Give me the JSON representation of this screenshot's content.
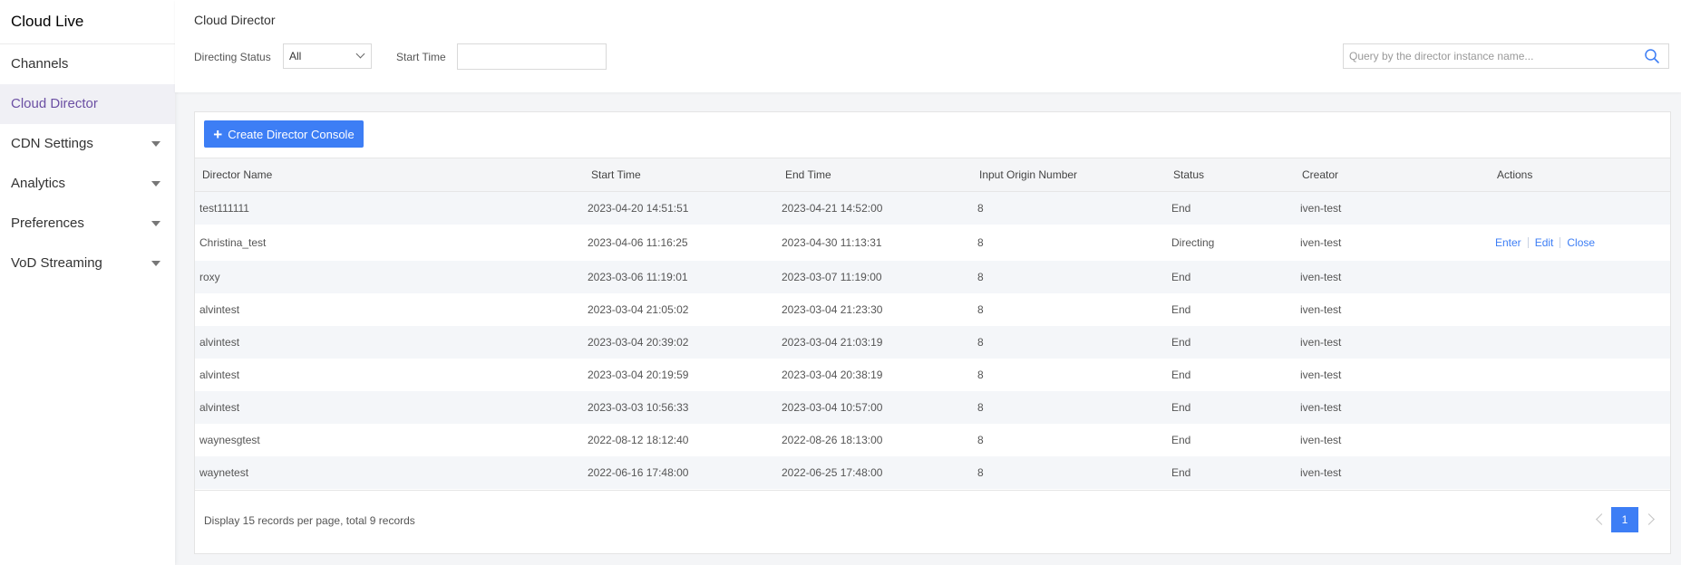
{
  "sidebar": {
    "brand": "Cloud Live",
    "items": [
      {
        "label": "Channels",
        "active": false,
        "expandable": false
      },
      {
        "label": "Cloud Director",
        "active": true,
        "expandable": false
      },
      {
        "label": "CDN Settings",
        "active": false,
        "expandable": true
      },
      {
        "label": "Analytics",
        "active": false,
        "expandable": true
      },
      {
        "label": "Preferences",
        "active": false,
        "expandable": true
      },
      {
        "label": "VoD Streaming",
        "active": false,
        "expandable": true
      }
    ]
  },
  "header": {
    "title": "Cloud Director",
    "filters": {
      "status_label": "Directing Status",
      "status_value": "All",
      "start_time_label": "Start Time",
      "start_time_value": ""
    },
    "search": {
      "placeholder": "Query by the director instance name..."
    }
  },
  "toolbar": {
    "create_label": "Create Director Console"
  },
  "table": {
    "columns": [
      "Director Name",
      "Start Time",
      "End Time",
      "Input Origin Number",
      "Status",
      "Creator",
      "Actions"
    ],
    "rows": [
      {
        "name": "test111111",
        "start": "2023-04-20 14:51:51",
        "end": "2023-04-21 14:52:00",
        "inputs": "8",
        "status": "End",
        "creator": "iven-test",
        "actions": []
      },
      {
        "name": "Christina_test",
        "start": "2023-04-06 11:16:25",
        "end": "2023-04-30 11:13:31",
        "inputs": "8",
        "status": "Directing",
        "creator": "iven-test",
        "actions": [
          "Enter",
          "Edit",
          "Close"
        ]
      },
      {
        "name": "roxy",
        "start": "2023-03-06 11:19:01",
        "end": "2023-03-07 11:19:00",
        "inputs": "8",
        "status": "End",
        "creator": "iven-test",
        "actions": []
      },
      {
        "name": "alvintest",
        "start": "2023-03-04 21:05:02",
        "end": "2023-03-04 21:23:30",
        "inputs": "8",
        "status": "End",
        "creator": "iven-test",
        "actions": []
      },
      {
        "name": "alvintest",
        "start": "2023-03-04 20:39:02",
        "end": "2023-03-04 21:03:19",
        "inputs": "8",
        "status": "End",
        "creator": "iven-test",
        "actions": []
      },
      {
        "name": "alvintest",
        "start": "2023-03-04 20:19:59",
        "end": "2023-03-04 20:38:19",
        "inputs": "8",
        "status": "End",
        "creator": "iven-test",
        "actions": []
      },
      {
        "name": "alvintest",
        "start": "2023-03-03 10:56:33",
        "end": "2023-03-04 10:57:00",
        "inputs": "8",
        "status": "End",
        "creator": "iven-test",
        "actions": []
      },
      {
        "name": "waynesgtest",
        "start": "2022-08-12 18:12:40",
        "end": "2022-08-26 18:13:00",
        "inputs": "8",
        "status": "End",
        "creator": "iven-test",
        "actions": []
      },
      {
        "name": "waynetest",
        "start": "2022-06-16 17:48:00",
        "end": "2022-06-25 17:48:00",
        "inputs": "8",
        "status": "End",
        "creator": "iven-test",
        "actions": []
      }
    ]
  },
  "pagination": {
    "summary": "Display 15 records per page, total 9 records",
    "current_page": "1"
  },
  "colors": {
    "accent": "#3d7ef5",
    "active_nav_text": "#6b4fa3",
    "active_nav_bg": "#f0f0f5"
  }
}
